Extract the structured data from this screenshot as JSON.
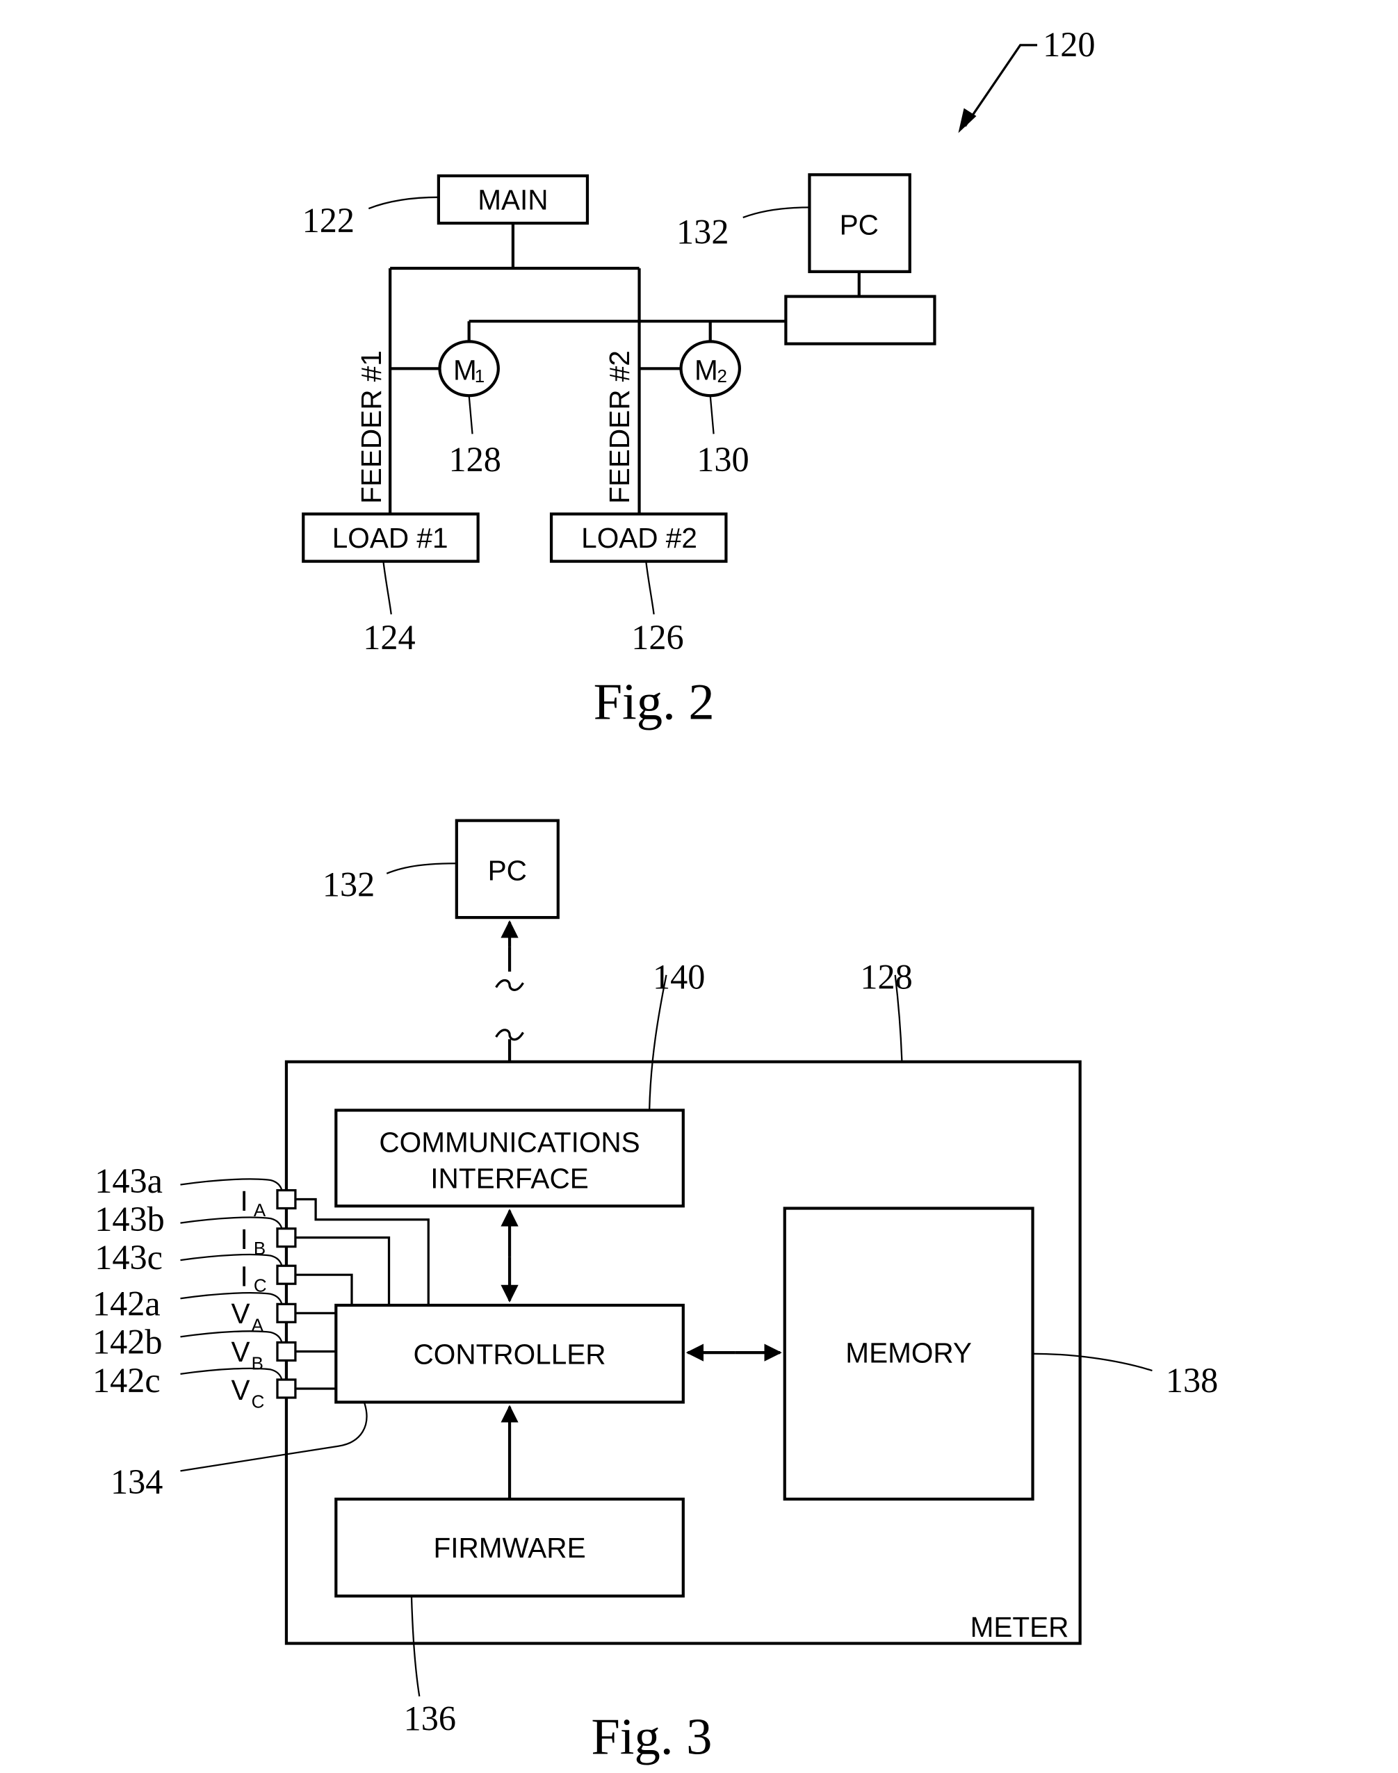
{
  "fig2": {
    "caption": "Fig. 2",
    "system_ref": "120",
    "main": {
      "label": "MAIN",
      "ref": "122"
    },
    "pc": {
      "label": "PC",
      "ref": "132"
    },
    "feeder1": {
      "label": "FEEDER #1"
    },
    "feeder2": {
      "label": "FEEDER #2"
    },
    "meter1": {
      "label": "M",
      "sub": "1",
      "ref": "128"
    },
    "meter2": {
      "label": "M",
      "sub": "2",
      "ref": "130"
    },
    "load1": {
      "label": "LOAD #1",
      "ref": "124"
    },
    "load2": {
      "label": "LOAD #2",
      "ref": "126"
    }
  },
  "fig3": {
    "caption": "Fig. 3",
    "pc": {
      "label": "PC",
      "ref": "132"
    },
    "meter": {
      "label": "METER",
      "ref": "128"
    },
    "comms": {
      "line1": "COMMUNICATIONS",
      "line2": "INTERFACE",
      "ref": "140"
    },
    "controller": {
      "label": "CONTROLLER",
      "ref": "134"
    },
    "memory": {
      "label": "MEMORY",
      "ref": "138"
    },
    "firmware": {
      "label": "FIRMWARE",
      "ref": "136"
    },
    "inputs": [
      {
        "ref": "143a",
        "main": "I",
        "sub": "A"
      },
      {
        "ref": "143b",
        "main": "I",
        "sub": "B"
      },
      {
        "ref": "143c",
        "main": "I",
        "sub": "C"
      },
      {
        "ref": "142a",
        "main": "V",
        "sub": "A"
      },
      {
        "ref": "142b",
        "main": "V",
        "sub": "B"
      },
      {
        "ref": "142c",
        "main": "V",
        "sub": "C"
      }
    ]
  }
}
